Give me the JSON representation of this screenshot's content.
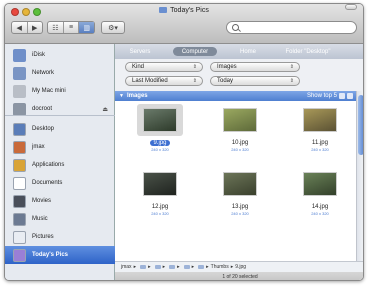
{
  "window": {
    "title": "Today's Pics"
  },
  "toolbar": {
    "back_label": "◀",
    "forward_label": "▶",
    "view_icons": "☷",
    "view_list": "≡",
    "view_columns": "▥",
    "action_label": "⚙▾",
    "search_value": ""
  },
  "sidebar": {
    "devices": [
      {
        "label": "iDisk",
        "icon": "idisk-icon",
        "color": "#6f8fc9"
      },
      {
        "label": "Network",
        "icon": "network-icon",
        "color": "#7a95c4"
      },
      {
        "label": "My Mac mini",
        "icon": "mac-mini-icon",
        "color": "#b9bec6"
      },
      {
        "label": "docroot",
        "icon": "drive-icon",
        "color": "#8b95a3"
      }
    ],
    "eject_glyph": "⏏",
    "places": [
      {
        "label": "Desktop",
        "icon": "desktop-icon",
        "color": "#5a7db8"
      },
      {
        "label": "jmax",
        "icon": "home-icon",
        "color": "#c96a3a"
      },
      {
        "label": "Applications",
        "icon": "applications-icon",
        "color": "#d9a437"
      },
      {
        "label": "Documents",
        "icon": "documents-icon",
        "color": "#ffffff"
      },
      {
        "label": "Movies",
        "icon": "movies-icon",
        "color": "#4a4f5a"
      },
      {
        "label": "Music",
        "icon": "music-icon",
        "color": "#6c7a92"
      },
      {
        "label": "Pictures",
        "icon": "pictures-icon",
        "color": "#e9edf3"
      },
      {
        "label": "Today's Pics",
        "icon": "smart-folder-icon",
        "color": "#9a7fd6"
      }
    ]
  },
  "scope": {
    "items": [
      "Servers",
      "Computer",
      "Home",
      "Folder \"Desktop\""
    ],
    "active_index": 1
  },
  "criteria": [
    {
      "field": "Kind",
      "value": "Images"
    },
    {
      "field": "Last Modified",
      "value": "Today"
    }
  ],
  "arrow_glyph": "⇕",
  "section": {
    "title": "Images",
    "triangle": "▼",
    "show_top": "Show top 5"
  },
  "images": [
    {
      "name": "9.jpg",
      "dims": "240 x 320",
      "colors": [
        "#6a7a6a",
        "#2d3a2a"
      ],
      "selected": true
    },
    {
      "name": "10.jpg",
      "dims": "240 x 320",
      "colors": [
        "#9aa860",
        "#5e6a3a"
      ],
      "selected": false
    },
    {
      "name": "11.jpg",
      "dims": "240 x 320",
      "colors": [
        "#a89858",
        "#5b5234"
      ],
      "selected": false
    },
    {
      "name": "12.jpg",
      "dims": "240 x 320",
      "colors": [
        "#4a5248",
        "#1f231f"
      ],
      "selected": false
    },
    {
      "name": "13.jpg",
      "dims": "240 x 320",
      "colors": [
        "#6c7558",
        "#3a402d"
      ],
      "selected": false
    },
    {
      "name": "14.jpg",
      "dims": "240 x 320",
      "colors": [
        "#6a8258",
        "#33402a"
      ],
      "selected": false
    }
  ],
  "pathbar": {
    "root": "jmax",
    "folders": [
      "",
      "",
      "",
      "",
      ""
    ],
    "thumbs": "Thumbs",
    "file": "9.jpg",
    "sep": "▸"
  },
  "status": {
    "text": "1 of 20 selected"
  }
}
